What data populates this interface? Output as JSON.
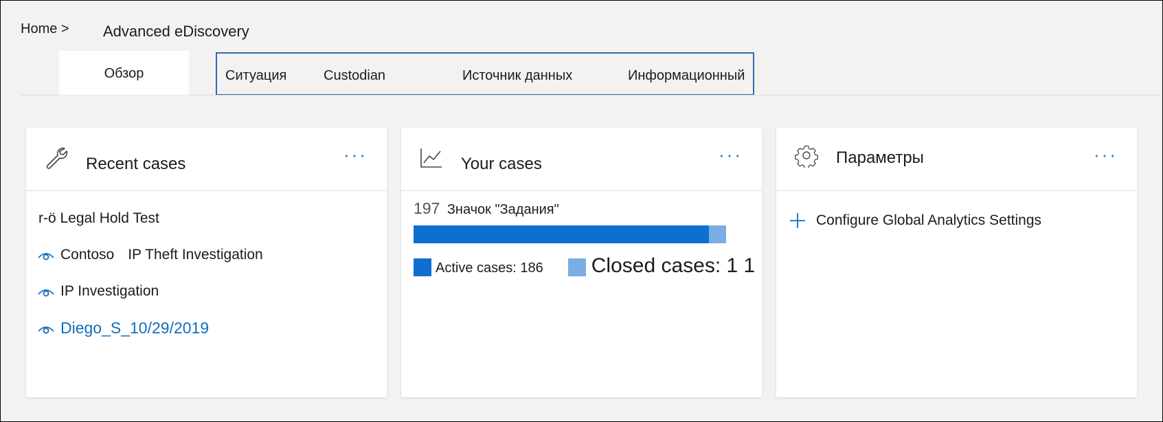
{
  "breadcrumb": {
    "home": "Home >",
    "current": "Advanced eDiscovery"
  },
  "tabs": {
    "overview": "Обзор",
    "items": [
      "Ситуация",
      "Custodian",
      "Источник данных",
      "Информационный"
    ]
  },
  "cards": {
    "recent": {
      "title": "Recent cases",
      "more": "···",
      "icon": "wrench-icon",
      "first_case": "r-ö Legal Hold Test",
      "cases": [
        {
          "prefix": "Contoso",
          "name": "IP Theft Investigation"
        },
        {
          "prefix": "",
          "name": "IP Investigation"
        },
        {
          "prefix": "",
          "name": "Diego_S_10/29/2019"
        }
      ]
    },
    "yours": {
      "title": "Your cases",
      "more": "···",
      "icon": "line-chart-icon",
      "total": "197",
      "total_label": "Значок \"Задания\"",
      "active_label": "Active cases: 186",
      "closed_label": "Closed cases: 1 1",
      "active_value": 186,
      "closed_value": 11,
      "colors": {
        "active": "#0f6fd0",
        "closed": "#79ade4"
      }
    },
    "settings": {
      "title": "Параметры",
      "more": "···",
      "icon": "gear-icon",
      "action": "Configure Global Analytics Settings",
      "action_icon": "plus-icon"
    }
  }
}
